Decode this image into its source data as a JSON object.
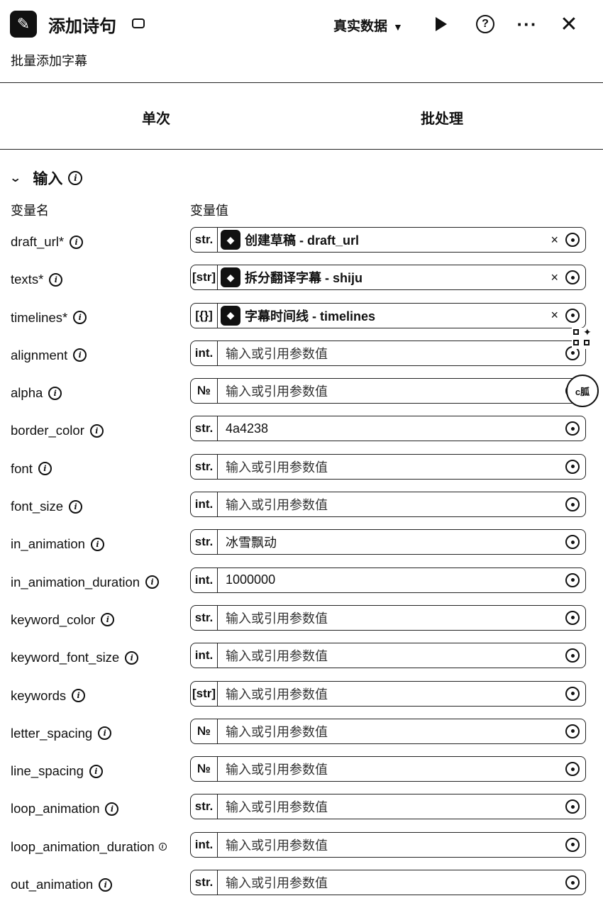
{
  "header": {
    "title": "添加诗句",
    "subtitle": "批量添加字幕",
    "data_mode": "真实数据"
  },
  "tabs": [
    "单次",
    "批处理"
  ],
  "section": {
    "title": "输入",
    "col_name": "变量名",
    "col_value": "变量值"
  },
  "floating": {
    "badge": "c胍"
  },
  "rows": [
    {
      "label": "draft_url*",
      "type": "str.",
      "ref_icon": "app-logo-icon",
      "value": "创建草稿 - draft_url",
      "ref": true
    },
    {
      "label": "texts*",
      "type": "[str]",
      "ref_icon": "robot-icon",
      "value": "拆分翻译字幕 - shiju",
      "ref": true
    },
    {
      "label": "timelines*",
      "type": "[{}]",
      "ref_icon": "ai-icon",
      "value": "字幕时间线 - timelines",
      "ref": true
    },
    {
      "label": "alignment",
      "type": "int.",
      "value": "输入或引用参数值",
      "placeholder": true
    },
    {
      "label": "alpha",
      "type": "№",
      "value": "输入或引用参数值",
      "placeholder": true
    },
    {
      "label": "border_color",
      "type": "str.",
      "value": "4a4238",
      "placeholder": false
    },
    {
      "label": "font",
      "type": "str.",
      "value": "输入或引用参数值",
      "placeholder": true
    },
    {
      "label": "font_size",
      "type": "int.",
      "value": "输入或引用参数值",
      "placeholder": true
    },
    {
      "label": "in_animation",
      "type": "str.",
      "value": "冰雪飘动",
      "placeholder": false
    },
    {
      "label": "in_animation_duration",
      "type": "int.",
      "value": "1000000",
      "placeholder": false
    },
    {
      "label": "keyword_color",
      "type": "str.",
      "value": "输入或引用参数值",
      "placeholder": true
    },
    {
      "label": "keyword_font_size",
      "type": "int.",
      "value": "输入或引用参数值",
      "placeholder": true
    },
    {
      "label": "keywords",
      "type": "[str]",
      "value": "输入或引用参数值",
      "placeholder": true
    },
    {
      "label": "letter_spacing",
      "type": "№",
      "value": "输入或引用参数值",
      "placeholder": true
    },
    {
      "label": "line_spacing",
      "type": "№",
      "value": "输入或引用参数值",
      "placeholder": true
    },
    {
      "label": "loop_animation",
      "type": "str.",
      "value": "输入或引用参数值",
      "placeholder": true
    },
    {
      "label": "loop_animation_duration",
      "type": "int.",
      "value": "输入或引用参数值",
      "placeholder": true
    },
    {
      "label": "out_animation",
      "type": "str.",
      "value": "输入或引用参数值",
      "placeholder": true
    }
  ]
}
